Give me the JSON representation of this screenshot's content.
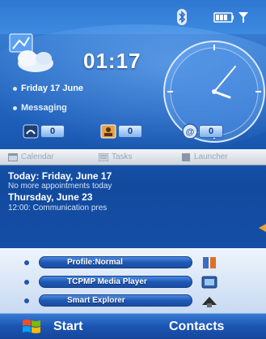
{
  "status": {
    "bluetooth_icon": "bluetooth-icon",
    "battery_icon": "battery-signal-icon"
  },
  "today": {
    "time": "01:17",
    "date": "Friday 17 June",
    "messaging": "Messaging",
    "counters": [
      {
        "icon": "missed-calls-icon",
        "value": "0"
      },
      {
        "icon": "sms-icon",
        "value": "0"
      },
      {
        "icon": "email-icon",
        "value": "0"
      }
    ]
  },
  "tabs": [
    {
      "label": "Calendar",
      "icon": "calendar-icon"
    },
    {
      "label": "Tasks",
      "icon": "tasks-icon"
    },
    {
      "label": "Launcher",
      "icon": "launcher-icon"
    }
  ],
  "calendar": {
    "line1": "Today: Friday, June 17",
    "line2": "No more appointments today",
    "line3": "Thursday, June 23",
    "line4": "12:00: Communication pres"
  },
  "launcher": [
    {
      "label": "Profile:Normal",
      "icon": "profile-icon"
    },
    {
      "label": "TCPMP Media Player",
      "icon": "media-player-icon"
    },
    {
      "label": "Smart Explorer",
      "icon": "explorer-icon"
    }
  ],
  "softkeys": {
    "left": "Start",
    "right": "Contacts"
  },
  "colors": {
    "accent": "#1e5fba",
    "bar": "#1b55b2"
  }
}
